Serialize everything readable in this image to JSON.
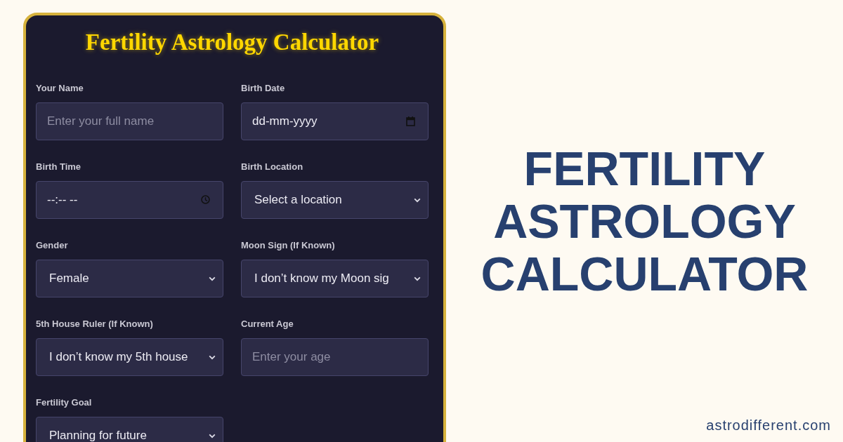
{
  "calculator": {
    "title": "Fertility Astrology Calculator",
    "fields": [
      {
        "label": "Your Name",
        "kind": "text",
        "placeholder": "Enter your full name"
      },
      {
        "label": "Birth Date",
        "kind": "date",
        "placeholder": "dd-mm-yyyy"
      },
      {
        "label": "Birth Time",
        "kind": "time",
        "placeholder": "--:-- --"
      },
      {
        "label": "Birth Location",
        "kind": "select",
        "value": "Select a location"
      },
      {
        "label": "Gender",
        "kind": "select",
        "value": "Female"
      },
      {
        "label": "Moon Sign (If Known)",
        "kind": "select",
        "value": "I don’t know my Moon sig"
      },
      {
        "label": "5th House Ruler (If Known)",
        "kind": "select",
        "value": "I don’t know my 5th house"
      },
      {
        "label": "Current Age",
        "kind": "text",
        "placeholder": "Enter your age"
      },
      {
        "label": "Fertility Goal",
        "kind": "select",
        "value": "Planning for future"
      }
    ]
  },
  "banner": {
    "heading": "FERTILITY ASTROLOGY CALCULATOR",
    "website": "astrodifferent.com"
  }
}
